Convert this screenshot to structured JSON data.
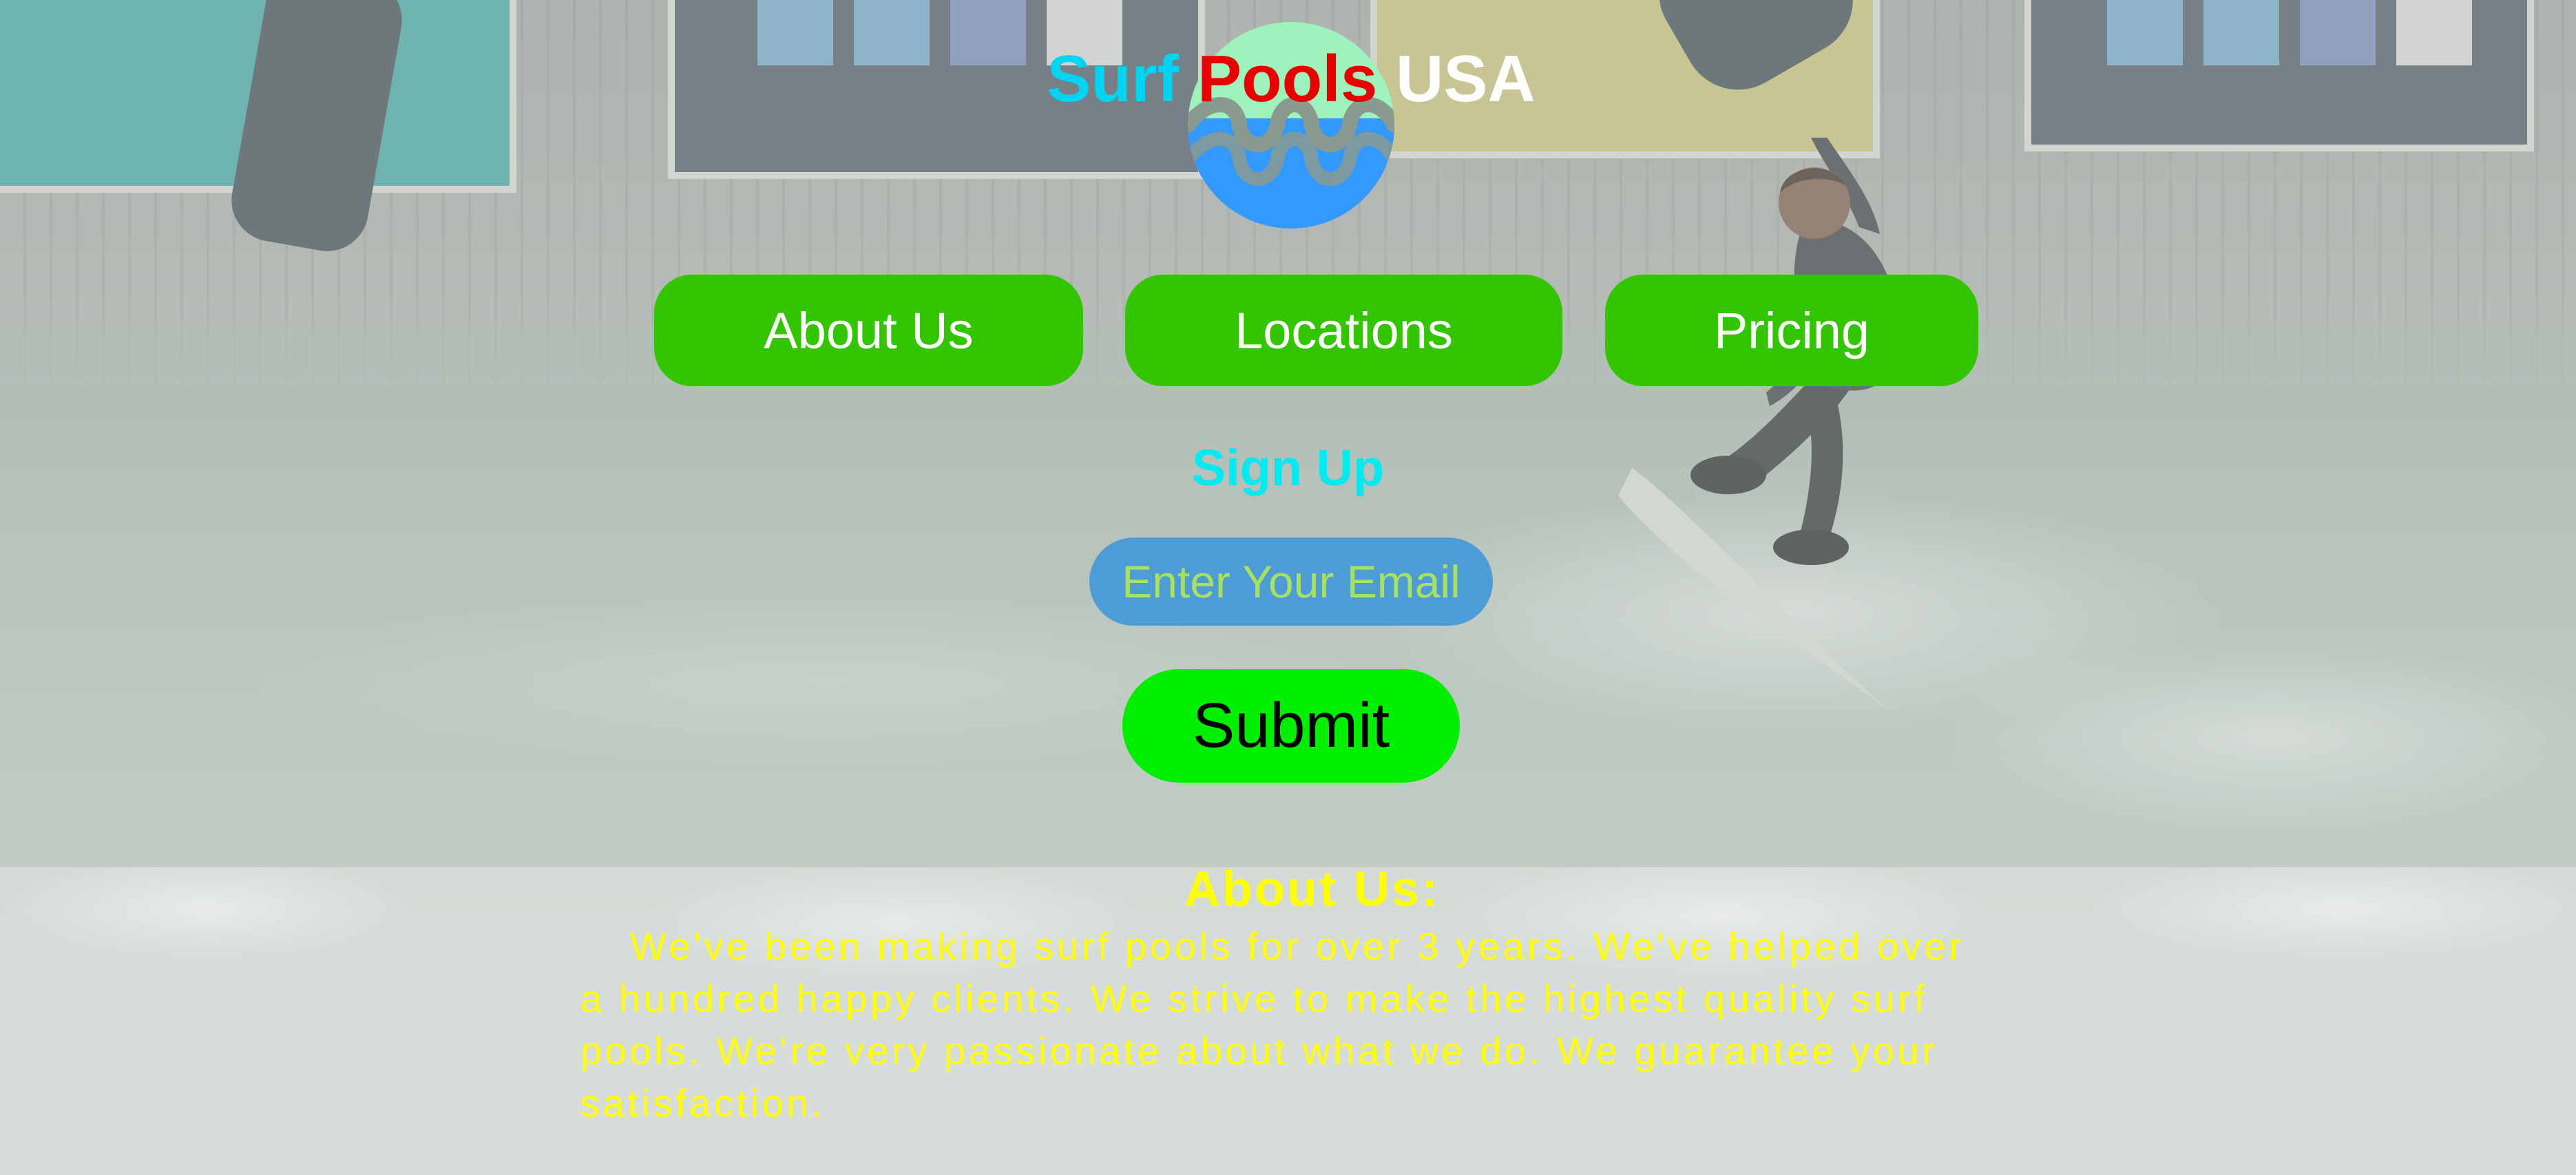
{
  "logo": {
    "word1": "Surf",
    "word2": "Pools",
    "word3": "USA",
    "emblem": "wave-circle-icon",
    "colors": {
      "word1": "#00d4f0",
      "word2": "#e60000",
      "word3": "#ffffff",
      "circle_top": "#9ef2bc",
      "circle_bottom": "#3399ff",
      "waves": "#8a9a8f"
    }
  },
  "nav": {
    "items": [
      {
        "label": "About Us"
      },
      {
        "label": "Locations"
      },
      {
        "label": "Pricing"
      }
    ],
    "button_color": "#33c500"
  },
  "signup": {
    "heading": "Sign Up",
    "email_placeholder": "Enter Your Email",
    "submit_label": "Submit",
    "colors": {
      "heading": "#00eaf2",
      "input_bg": "#4d9cd6",
      "input_text": "#a8e060",
      "submit_bg": "#00ee00"
    }
  },
  "about": {
    "heading": "About Us:",
    "body": "We've been making surf pools for over 3 years. We've helped over a hundred happy clients. We strive to make the highest quality surf pools. We're very passionate about what we do. We guarantee your satisfaction.",
    "color": "#ffff00"
  }
}
